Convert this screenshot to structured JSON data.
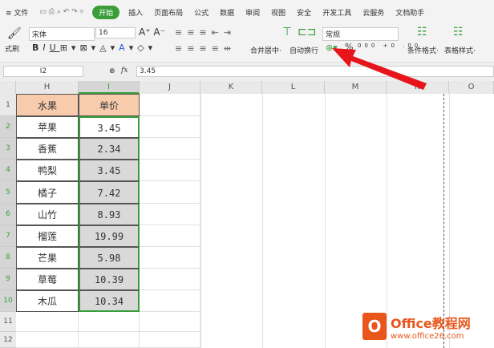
{
  "menu": {
    "file": "≡ 文件",
    "tabs": [
      "开始",
      "插入",
      "页面布局",
      "公式",
      "数据",
      "审阅",
      "视图",
      "安全",
      "开发工具",
      "云服务",
      "文档助手"
    ]
  },
  "ribbon": {
    "format_painter": "式刷",
    "font": "宋体",
    "size": "16",
    "merge": "合并居中·",
    "wrap": "自动换行",
    "number_format": "常规",
    "percent": "%",
    "cond_format": "条件格式·",
    "table_style": "表格样式·"
  },
  "formula_bar": {
    "cell_ref": "I2",
    "fx": "fx",
    "value": "3.45"
  },
  "columns": [
    "H",
    "I",
    "J",
    "K",
    "L",
    "M",
    "N",
    "O"
  ],
  "rows": [
    "1",
    "2",
    "3",
    "4",
    "5",
    "6",
    "7",
    "8",
    "9",
    "10",
    "11",
    "12"
  ],
  "table": {
    "headers": [
      "水果",
      "单价"
    ],
    "data": [
      [
        "苹果",
        "3.45"
      ],
      [
        "香蕉",
        "2.34"
      ],
      [
        "鸭梨",
        "3.45"
      ],
      [
        "橘子",
        "7.42"
      ],
      [
        "山竹",
        "8.93"
      ],
      [
        "榴莲",
        "19.99"
      ],
      [
        "芒果",
        "5.98"
      ],
      [
        "草莓",
        "10.39"
      ],
      [
        "木瓜",
        "10.34"
      ]
    ]
  },
  "watermark": {
    "brand": "Office教程网",
    "url": "www.office26.com"
  },
  "colors": {
    "accent": "#3a9d3a",
    "header_fill": "#f8cbad",
    "selection_fill": "#d9d9d9",
    "arrow": "#e8141b"
  }
}
